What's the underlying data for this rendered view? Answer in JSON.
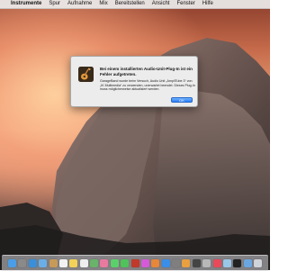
{
  "menubar": {
    "apple_glyph": "",
    "items": [
      "Instrumente",
      "Spur",
      "Aufnahme",
      "Mix",
      "Bereitstellen",
      "Ansicht",
      "Fenster",
      "Hilfe"
    ]
  },
  "dialog": {
    "icon": "garageband-guitar-icon",
    "title": "Bei einem installierten Audio-Unit-Plug-In ist ein Fehler aufgetreten.",
    "message": "GarageBand wurde beim Versuch, Audio Unit „AmpliTube 3“ von „IK Multimedia“ zu verwenden, unerwartet beendet. Dieses Plug-In muss möglicherweise aktualisiert werden.",
    "ok_label": "OK"
  },
  "dock": {
    "icons": [
      {
        "name": "finder-icon",
        "color": "#4a9ee8"
      },
      {
        "name": "launchpad-icon",
        "color": "#8a8a8a"
      },
      {
        "name": "safari-icon",
        "color": "#3a8fd8"
      },
      {
        "name": "mail-icon",
        "color": "#6aaee8"
      },
      {
        "name": "contacts-icon",
        "color": "#c79a5a"
      },
      {
        "name": "calendar-icon",
        "color": "#f2f2f2"
      },
      {
        "name": "notes-icon",
        "color": "#f3d25a"
      },
      {
        "name": "reminders-icon",
        "color": "#eeeeee"
      },
      {
        "name": "maps-icon",
        "color": "#69b36a"
      },
      {
        "name": "photos-icon",
        "color": "#e87aa0"
      },
      {
        "name": "messages-icon",
        "color": "#5bd06a"
      },
      {
        "name": "facetime-icon",
        "color": "#4fc25a"
      },
      {
        "name": "photo-booth-icon",
        "color": "#c0392b"
      },
      {
        "name": "itunes-icon",
        "color": "#d65ad8"
      },
      {
        "name": "ibooks-icon",
        "color": "#e8863a"
      },
      {
        "name": "app-store-icon",
        "color": "#3a8ee8"
      },
      {
        "name": "system-preferences-icon",
        "color": "#7f7f7f"
      },
      {
        "name": "garageband-icon",
        "color": "#e8a040"
      },
      {
        "name": "logic-icon",
        "color": "#444444"
      },
      {
        "name": "mainstage-icon",
        "color": "#b8b8b8"
      },
      {
        "name": "music-icon",
        "color": "#e84a5a"
      },
      {
        "name": "preview-icon",
        "color": "#9ac6e8"
      },
      {
        "name": "terminal-icon",
        "color": "#222222"
      },
      {
        "name": "downloads-icon",
        "color": "#6aa6e0"
      },
      {
        "name": "trash-icon",
        "color": "#cfd4da"
      }
    ]
  }
}
